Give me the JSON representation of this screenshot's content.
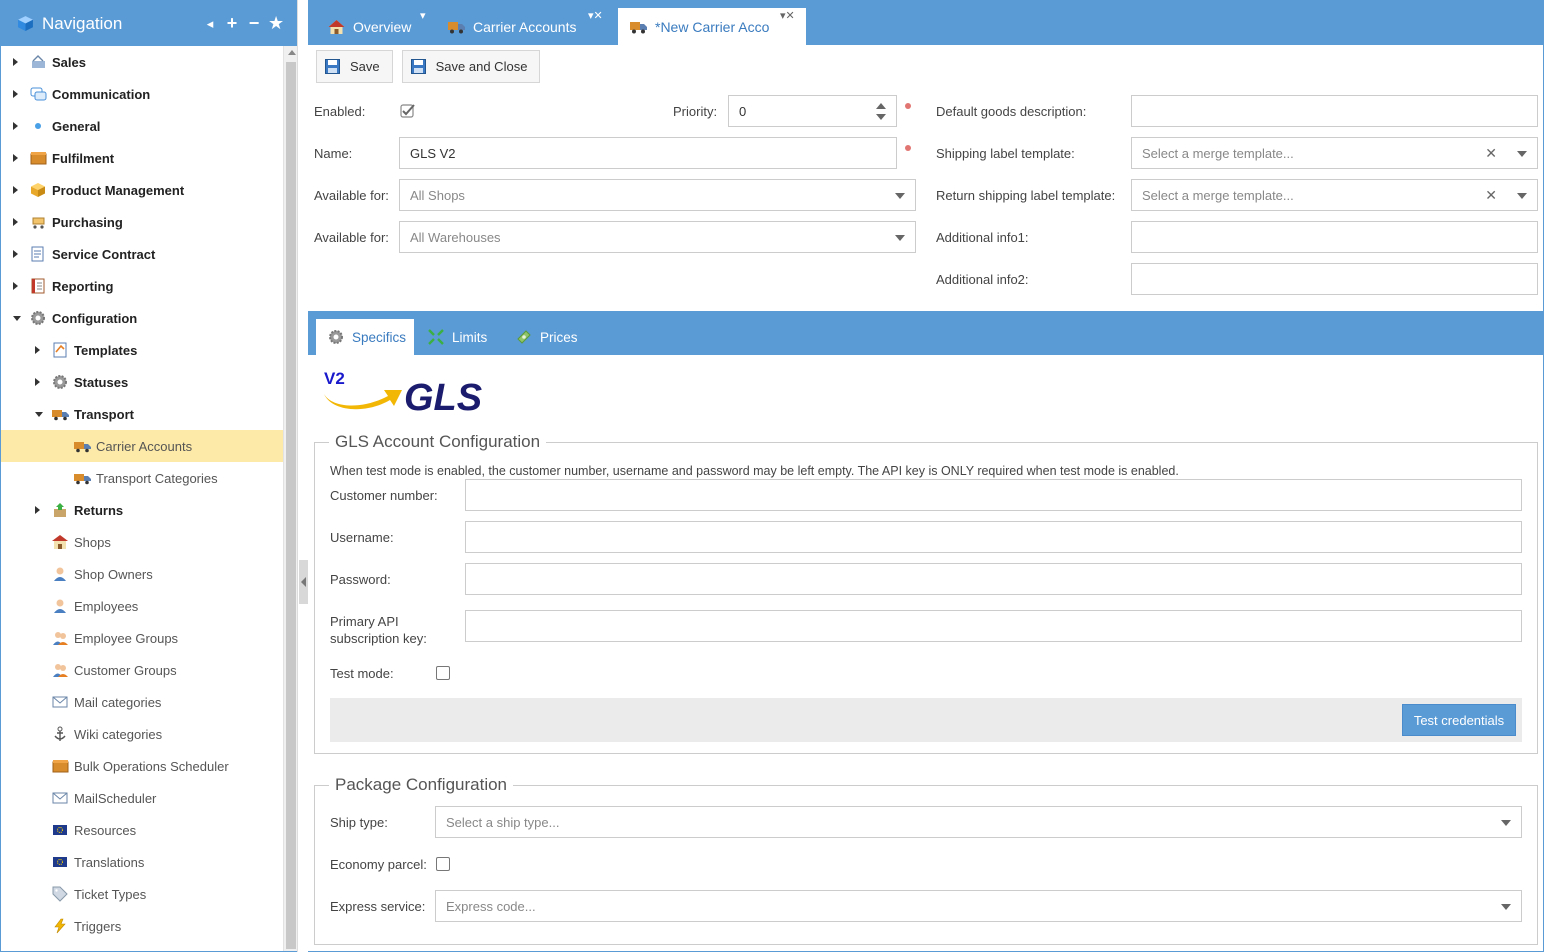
{
  "nav": {
    "title": "Navigation",
    "tools": [
      "◂",
      "+",
      "−",
      "★"
    ],
    "items": [
      {
        "label": "Sales",
        "icon": "basket-icon",
        "level": 0,
        "caret": "right"
      },
      {
        "label": "Communication",
        "icon": "chat-bubbles-icon",
        "level": 0,
        "caret": "right"
      },
      {
        "label": "General",
        "icon": "dot-icon",
        "level": 0,
        "caret": "right"
      },
      {
        "label": "Fulfilment",
        "icon": "box-icon",
        "level": 0,
        "caret": "right"
      },
      {
        "label": "Product Management",
        "icon": "cube-icon",
        "level": 0,
        "caret": "right"
      },
      {
        "label": "Purchasing",
        "icon": "cart-icon",
        "level": 0,
        "caret": "right"
      },
      {
        "label": "Service Contract",
        "icon": "contract-icon",
        "level": 0,
        "caret": "right"
      },
      {
        "label": "Reporting",
        "icon": "report-icon",
        "level": 0,
        "caret": "right"
      },
      {
        "label": "Configuration",
        "icon": "gear-icon",
        "level": 0,
        "caret": "down"
      },
      {
        "label": "Templates",
        "icon": "template-icon",
        "level": 1,
        "caret": "right"
      },
      {
        "label": "Statuses",
        "icon": "gear-icon",
        "level": 1,
        "caret": "right"
      },
      {
        "label": "Transport",
        "icon": "truck-icon",
        "level": 1,
        "caret": "down"
      },
      {
        "label": "Carrier Accounts",
        "icon": "truck-icon",
        "level": 2,
        "selected": true
      },
      {
        "label": "Transport Categories",
        "icon": "truck-icon",
        "level": 2
      },
      {
        "label": "Returns",
        "icon": "return-icon",
        "level": 1,
        "caret": "right"
      },
      {
        "label": "Shops",
        "icon": "shop-icon",
        "level": 1
      },
      {
        "label": "Shop Owners",
        "icon": "person-icon",
        "level": 1
      },
      {
        "label": "Employees",
        "icon": "person-icon",
        "level": 1
      },
      {
        "label": "Employee Groups",
        "icon": "group-icon",
        "level": 1
      },
      {
        "label": "Customer Groups",
        "icon": "group-icon",
        "level": 1
      },
      {
        "label": "Mail categories",
        "icon": "mail-icon",
        "level": 1
      },
      {
        "label": "Wiki categories",
        "icon": "anchor-icon",
        "level": 1
      },
      {
        "label": "Bulk Operations Scheduler",
        "icon": "box-icon",
        "level": 1
      },
      {
        "label": "MailScheduler",
        "icon": "mail-icon",
        "level": 1
      },
      {
        "label": "Resources",
        "icon": "flag-icon",
        "level": 1
      },
      {
        "label": "Translations",
        "icon": "flag-icon",
        "level": 1
      },
      {
        "label": "Ticket Types",
        "icon": "tag-icon",
        "level": 1
      },
      {
        "label": "Triggers",
        "icon": "lightning-icon",
        "level": 1
      }
    ]
  },
  "tabs": [
    {
      "label": "Overview",
      "icon": "home-icon"
    },
    {
      "label": "Carrier Accounts",
      "icon": "truck-icon"
    },
    {
      "label": "*New Carrier Acco",
      "icon": "truck-icon",
      "active": true
    }
  ],
  "toolbar": {
    "save_label": "Save",
    "save_close_label": "Save and Close"
  },
  "form": {
    "enabled_label": "Enabled:",
    "enabled_checked": true,
    "priority_label": "Priority:",
    "priority_value": "0",
    "name_label": "Name:",
    "name_value": "GLS V2",
    "available_for_label": "Available for:",
    "available_shops_placeholder": "All Shops",
    "available_warehouses_placeholder": "All Warehouses",
    "default_goods_label": "Default goods description:",
    "default_goods_value": "",
    "shipping_label_template_label": "Shipping label template:",
    "shipping_label_template_placeholder": "Select a merge template...",
    "return_label_template_label": "Return shipping label template:",
    "return_label_template_placeholder": "Select a merge template...",
    "additional_info1_label": "Additional info1:",
    "additional_info2_label": "Additional info2:"
  },
  "subtabs": [
    {
      "label": "Specifics",
      "icon": "gear-icon",
      "active": true
    },
    {
      "label": "Limits",
      "icon": "limits-icon"
    },
    {
      "label": "Prices",
      "icon": "money-icon"
    }
  ],
  "logo": {
    "badge": "V2",
    "text": "GLS",
    "badge_color": "#1a1acc",
    "text_color": "#1c1c6e",
    "arrow_color": "#f2b705"
  },
  "gls_config": {
    "legend": "GLS Account Configuration",
    "note": "When test mode is enabled, the customer number, username and password may be left empty. The API key is ONLY required when test mode is enabled.",
    "customer_number_label": "Customer number:",
    "username_label": "Username:",
    "password_label": "Password:",
    "api_key_label_line1": "Primary API",
    "api_key_label_line2": "subscription key:",
    "test_mode_label": "Test mode:",
    "test_button_label": "Test credentials"
  },
  "package_config": {
    "legend": "Package Configuration",
    "ship_type_label": "Ship type:",
    "ship_type_placeholder": "Select a ship type...",
    "economy_label": "Economy parcel:",
    "express_label": "Express service:",
    "express_placeholder": "Express code..."
  },
  "colors": {
    "accent": "#5b9bd5",
    "selected_row": "#fdeaa8",
    "required_dot": "#d9534f"
  }
}
